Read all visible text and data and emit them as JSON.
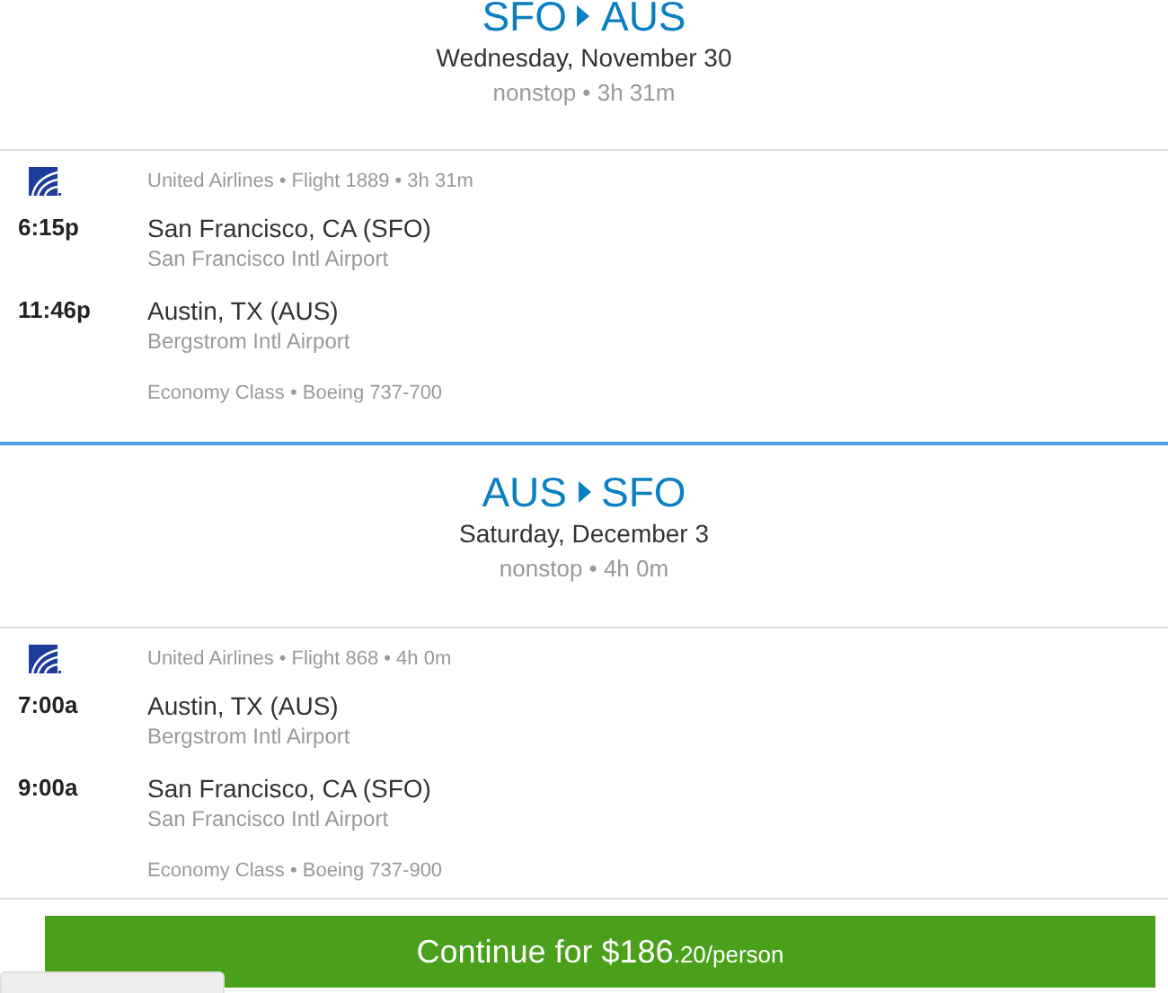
{
  "legs": [
    {
      "origin": "SFO",
      "destination": "AUS",
      "date": "Wednesday, November 30",
      "summary": "nonstop • 3h 31m",
      "segment": {
        "meta": "United Airlines • Flight 1889 • 3h 31m",
        "stops": [
          {
            "time": "6:15p",
            "city": "San Francisco, CA (SFO)",
            "airport": "San Francisco Intl Airport"
          },
          {
            "time": "11:46p",
            "city": "Austin, TX (AUS)",
            "airport": "Bergstrom Intl Airport"
          }
        ],
        "details": "Economy Class • Boeing 737-700"
      }
    },
    {
      "origin": "AUS",
      "destination": "SFO",
      "date": "Saturday, December 3",
      "summary": "nonstop • 4h 0m",
      "segment": {
        "meta": "United Airlines • Flight 868 • 4h 0m",
        "stops": [
          {
            "time": "7:00a",
            "city": "Austin, TX (AUS)",
            "airport": "Bergstrom Intl Airport"
          },
          {
            "time": "9:00a",
            "city": "San Francisco, CA (SFO)",
            "airport": "San Francisco Intl Airport"
          }
        ],
        "details": "Economy Class • Boeing 737-900"
      }
    }
  ],
  "continue_button": {
    "label": "Continue for $186",
    "price_suffix": ".20/person"
  }
}
